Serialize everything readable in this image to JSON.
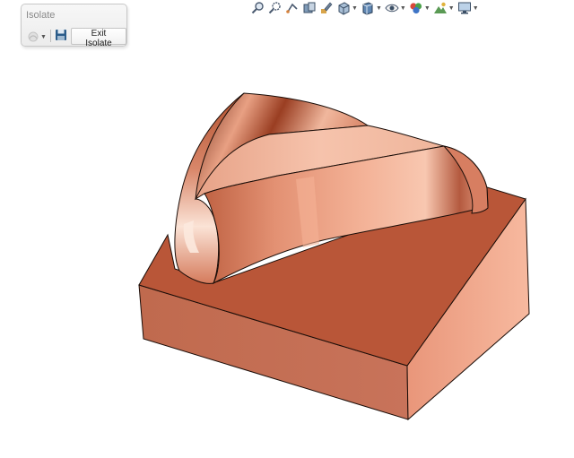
{
  "isolate_panel": {
    "title": "Isolate",
    "exit_label": "Exit Isolate"
  },
  "toolbar": {
    "items": [
      {
        "name": "zoom-to-fit-icon"
      },
      {
        "name": "zoom-to-area-icon"
      },
      {
        "name": "previous-view-icon"
      },
      {
        "name": "section-view-icon"
      },
      {
        "name": "dynamic-annotation-icon"
      },
      {
        "name": "view-orientation-icon",
        "dropdown": true
      },
      {
        "name": "display-style-icon",
        "dropdown": true
      },
      {
        "name": "hide-show-items-icon",
        "dropdown": true
      },
      {
        "name": "edit-appearance-icon",
        "dropdown": true
      },
      {
        "name": "apply-scene-icon",
        "dropdown": true
      },
      {
        "name": "view-settings-icon",
        "dropdown": true
      }
    ]
  },
  "model": {
    "colors": {
      "base_top": "#b95638",
      "base_front": "#c46e52",
      "base_right": "#f3aa8d",
      "edge": "#1a0d08",
      "arch_highlight": "#f8c8b2",
      "arch_dark": "#7a2c18"
    }
  }
}
